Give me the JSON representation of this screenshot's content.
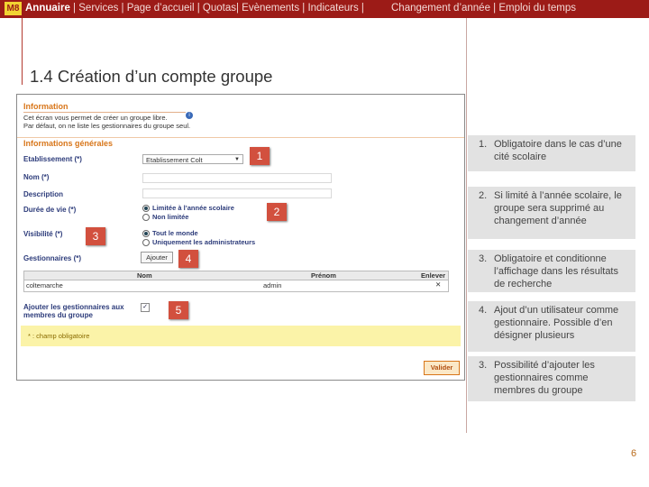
{
  "nav": {
    "logo": "M8",
    "active": "Annuaire",
    "sep1": "|",
    "items_left": "Services | Page d’accueil | Quotas| Evènements | Indicateurs |",
    "items_right": "Changement d’année  | Emploi du temps"
  },
  "page_title": "1.4 Création d’un compte groupe",
  "form": {
    "info_header": "Information",
    "info_line1": "Cet écran vous permet de créer un groupe libre.",
    "info_line2": "Par défaut, on ne liste les gestionnaires du groupe seul.",
    "general_header": "Informations générales",
    "etab_label": "Etablissement (*)",
    "etab_value": "Etablissement Colt",
    "nom_label": "Nom (*)",
    "desc_label": "Description",
    "duree_label": "Durée de vie (*)",
    "duree_opt1": "Limitée à l’année scolaire",
    "duree_opt2": "Non limitée",
    "visib_label": "Visibilité (*)",
    "visib_opt1": "Tout le monde",
    "visib_opt2": "Uniquement les administrateurs",
    "gest_label": "Gestionnaires (*)",
    "ajouter": "Ajouter",
    "col_nom": "Nom",
    "col_prenom": "Prénom",
    "col_enlever": "Enlever",
    "row_nom": "coltemarche",
    "row_prenom": "admin",
    "row_x": "✕",
    "add_gest_label": "Ajouter les gestionnaires aux membres du groupe",
    "check": "✓",
    "mandatory": "* : champ obligatoire",
    "valider": "Valider"
  },
  "badges": [
    "1",
    "2",
    "3",
    "4",
    "5"
  ],
  "notes": [
    {
      "num": "1.",
      "text": "Obligatoire dans le cas d’une cité scolaire"
    },
    {
      "num": "2.",
      "text": "Si limité à l’année scolaire, le groupe sera supprimé au changement d’année"
    },
    {
      "num": "3.",
      "text": "Obligatoire et conditionne l’affichage dans les résultats de recherche"
    },
    {
      "num": "4.",
      "text": "Ajout d’un utilisateur comme gestionnaire. Possible d’en désigner plusieurs"
    },
    {
      "num": "3.",
      "text": "Possibilité d’ajouter les gestionnaires comme membres du groupe"
    }
  ],
  "page_number": "6",
  "colors": {
    "banner": "#9c1b17",
    "badge": "#d2503e",
    "section": "#d8761a",
    "label": "#2c3b7a"
  }
}
